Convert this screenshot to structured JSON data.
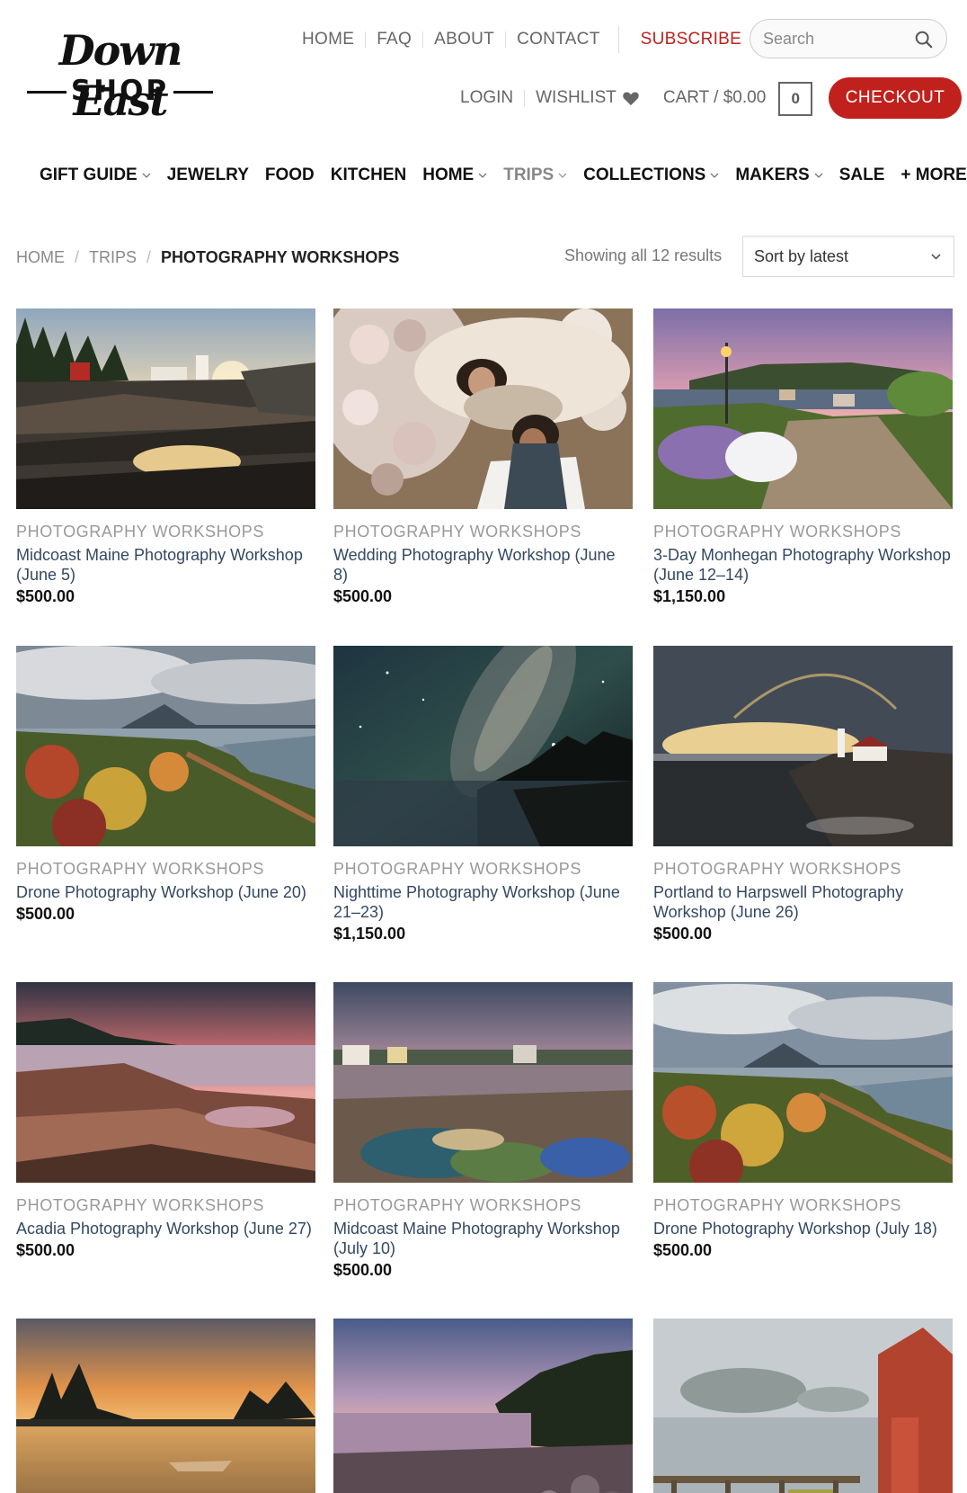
{
  "brand": {
    "script": "Down East",
    "word": "SHOP"
  },
  "topnav": {
    "items": [
      "HOME",
      "FAQ",
      "ABOUT",
      "CONTACT"
    ],
    "subscribe": "SUBSCRIBE"
  },
  "search": {
    "placeholder": "Search"
  },
  "account": {
    "login": "LOGIN",
    "wishlist": "WISHLIST",
    "cart_label": "CART / $0.00",
    "cart_count": "0",
    "checkout": "CHECKOUT"
  },
  "mainnav": [
    {
      "label": "GIFT GUIDE",
      "dropdown": true
    },
    {
      "label": "JEWELRY",
      "dropdown": false
    },
    {
      "label": "FOOD",
      "dropdown": false
    },
    {
      "label": "KITCHEN",
      "dropdown": false
    },
    {
      "label": "HOME",
      "dropdown": true
    },
    {
      "label": "TRIPS",
      "dropdown": true
    },
    {
      "label": "COLLECTIONS",
      "dropdown": true
    },
    {
      "label": "MAKERS",
      "dropdown": true
    },
    {
      "label": "SALE",
      "dropdown": false
    },
    {
      "label": "+ MORE",
      "dropdown": true
    }
  ],
  "breadcrumb": {
    "home": "HOME",
    "trips": "TRIPS",
    "current": "PHOTOGRAPHY WORKSHOPS"
  },
  "toolbar": {
    "results": "Showing all 12 results",
    "sort": "Sort by latest"
  },
  "products": [
    {
      "category": "PHOTOGRAPHY WORKSHOPS",
      "title": "Midcoast Maine Photography Workshop (June 5)",
      "price": "$500.00"
    },
    {
      "category": "PHOTOGRAPHY WORKSHOPS",
      "title": "Wedding Photography Workshop (June 8)",
      "price": "$500.00"
    },
    {
      "category": "PHOTOGRAPHY WORKSHOPS",
      "title": "3-Day Monhegan Photography Workshop (June 12–14)",
      "price": "$1,150.00"
    },
    {
      "category": "PHOTOGRAPHY WORKSHOPS",
      "title": "Drone Photography Workshop (June 20)",
      "price": "$500.00"
    },
    {
      "category": "PHOTOGRAPHY WORKSHOPS",
      "title": "Nighttime Photography Workshop (June 21–23)",
      "price": "$1,150.00"
    },
    {
      "category": "PHOTOGRAPHY WORKSHOPS",
      "title": "Portland to Harpswell Photography Workshop (June 26)",
      "price": "$500.00"
    },
    {
      "category": "PHOTOGRAPHY WORKSHOPS",
      "title": "Acadia Photography Workshop (June 27)",
      "price": "$500.00"
    },
    {
      "category": "PHOTOGRAPHY WORKSHOPS",
      "title": "Midcoast Maine Photography Workshop (July 10)",
      "price": "$500.00"
    },
    {
      "category": "PHOTOGRAPHY WORKSHOPS",
      "title": "Drone Photography Workshop (July 18)",
      "price": "$500.00"
    }
  ],
  "colors": {
    "accent": "#c0211c",
    "link": "#334862"
  }
}
